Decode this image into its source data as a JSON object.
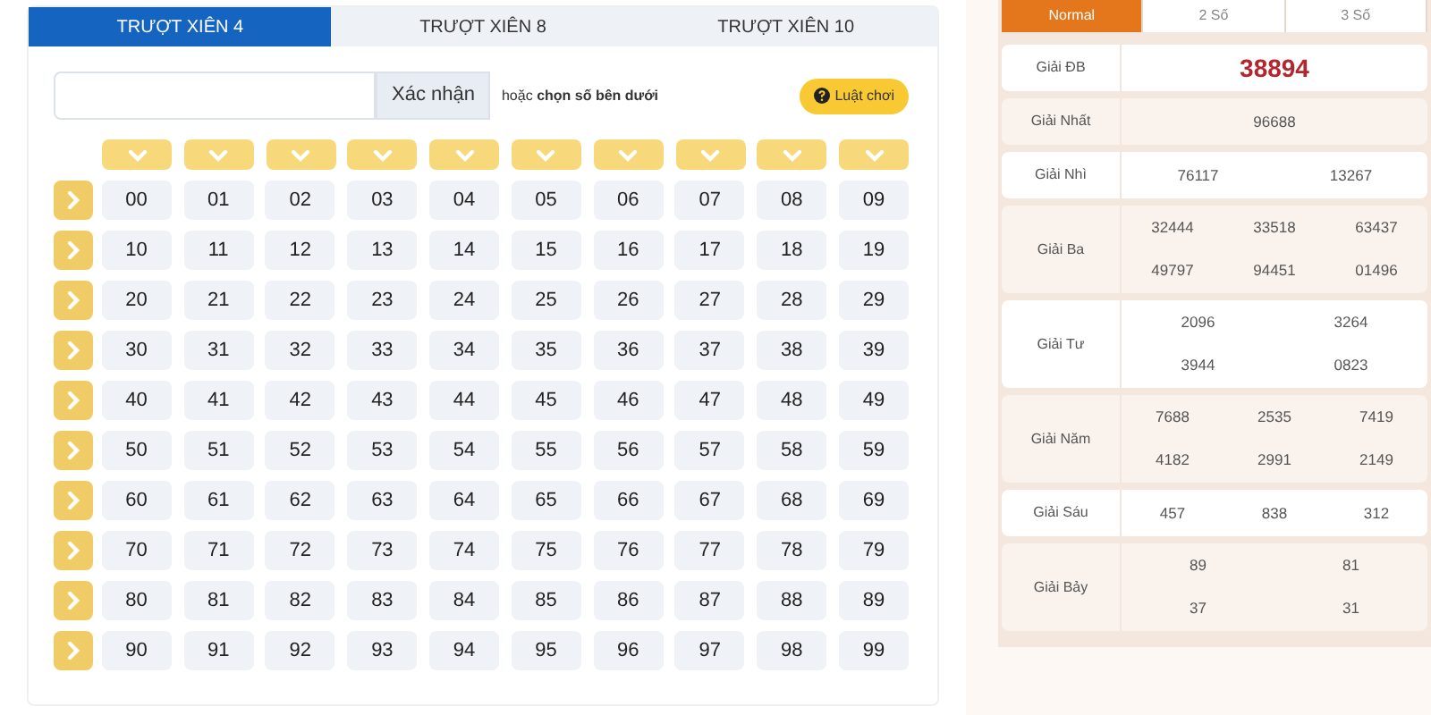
{
  "tabs": [
    {
      "label": "TRƯỢT XIÊN 4",
      "selected": true
    },
    {
      "label": "TRƯỢT XIÊN 8",
      "selected": false
    },
    {
      "label": "TRƯỢT XIÊN 10",
      "selected": false
    }
  ],
  "confirm_button": "Xác nhận",
  "hint": "hoặc **chọn số bên dưới**",
  "rules_button": "Luật chơi",
  "numbers": [
    "00",
    "01",
    "02",
    "03",
    "04",
    "05",
    "06",
    "07",
    "08",
    "09",
    "10",
    "11",
    "12",
    "13",
    "14",
    "15",
    "16",
    "17",
    "18",
    "19",
    "20",
    "21",
    "22",
    "23",
    "24",
    "25",
    "26",
    "27",
    "28",
    "29",
    "30",
    "31",
    "32",
    "33",
    "34",
    "35",
    "36",
    "37",
    "38",
    "39",
    "40",
    "41",
    "42",
    "43",
    "44",
    "45",
    "46",
    "47",
    "48",
    "49",
    "50",
    "51",
    "52",
    "53",
    "54",
    "55",
    "56",
    "57",
    "58",
    "59",
    "60",
    "61",
    "62",
    "63",
    "64",
    "65",
    "66",
    "67",
    "68",
    "69",
    "70",
    "71",
    "72",
    "73",
    "74",
    "75",
    "76",
    "77",
    "78",
    "79",
    "80",
    "81",
    "82",
    "83",
    "84",
    "85",
    "86",
    "87",
    "88",
    "89",
    "90",
    "91",
    "92",
    "93",
    "94",
    "95",
    "96",
    "97",
    "98",
    "99"
  ],
  "result_tabs": [
    {
      "label": "Normal",
      "selected": true
    },
    {
      "label": "2 Số",
      "selected": false
    },
    {
      "label": "3 Số",
      "selected": false
    }
  ],
  "results": [
    {
      "prize": "Giải ĐB",
      "kind": "special",
      "lines": [
        [
          "38894"
        ]
      ]
    },
    {
      "prize": "Giải Nhất",
      "kind": "normal",
      "lines": [
        [
          "96688"
        ]
      ]
    },
    {
      "prize": "Giải Nhì",
      "kind": "normal",
      "lines": [
        [
          "76117",
          "13267"
        ]
      ]
    },
    {
      "prize": "Giải Ba",
      "kind": "normal",
      "lines": [
        [
          "32444",
          "33518",
          "63437"
        ],
        [
          "49797",
          "94451",
          "01496"
        ]
      ]
    },
    {
      "prize": "Giải Tư",
      "kind": "normal",
      "lines": [
        [
          "2096",
          "3264"
        ],
        [
          "3944",
          "0823"
        ]
      ]
    },
    {
      "prize": "Giải Năm",
      "kind": "normal",
      "lines": [
        [
          "7688",
          "2535",
          "7419"
        ],
        [
          "4182",
          "2991",
          "2149"
        ]
      ]
    },
    {
      "prize": "Giải Sáu",
      "kind": "normal",
      "lines": [
        [
          "457",
          "838",
          "312"
        ]
      ]
    },
    {
      "prize": "Giải Bảy",
      "kind": "normal",
      "lines": [
        [
          "89",
          "81"
        ],
        [
          "37",
          "31"
        ]
      ]
    }
  ]
}
